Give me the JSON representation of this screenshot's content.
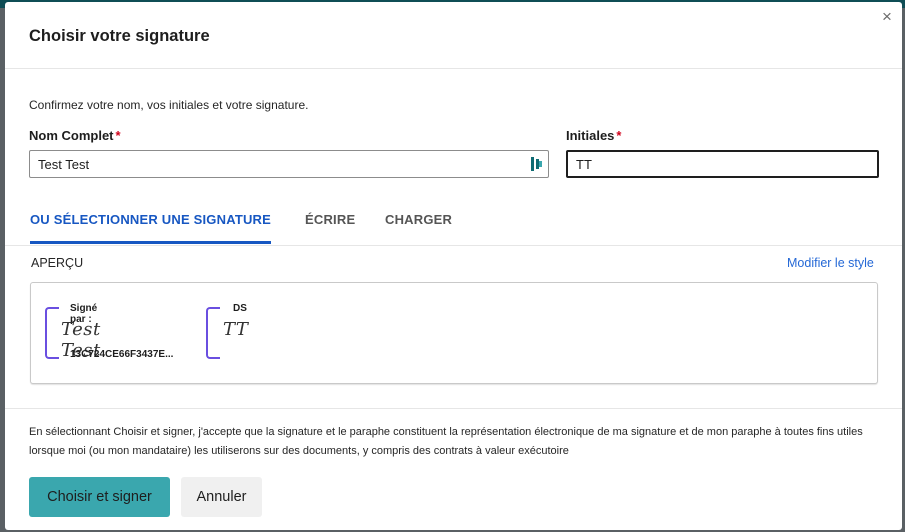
{
  "dialog": {
    "title": "Choisir votre signature",
    "close_glyph": "×",
    "intro": "Confirmez votre nom, vos initiales et votre signature."
  },
  "form": {
    "full_name_label": "Nom Complet",
    "full_name_value": "Test Test",
    "initials_label": "Initiales",
    "initials_value": "TT",
    "required_mark": "*"
  },
  "tabs": [
    {
      "label": "OU SÉLECTIONNER UNE SIGNATURE",
      "active": true
    },
    {
      "label": "ÉCRIRE",
      "active": false
    },
    {
      "label": "CHARGER",
      "active": false
    }
  ],
  "preview": {
    "label": "APERÇU",
    "modify_link": "Modifier le style",
    "signature": {
      "signed_by_label": "Signé par :",
      "script_text": "Test Test",
      "id": "13C724CE66F3437E..."
    },
    "initials": {
      "label": "DS",
      "script_text": "TT"
    }
  },
  "disclaimer": "En sélectionnant Choisir et signer, j'accepte que la signature et le paraphe constituent la représentation électronique de ma signature et de mon paraphe à toutes fins utiles lorsque moi (ou mon mandataire) les utiliserons sur des documents, y compris des contrats à valeur exécutoire",
  "buttons": {
    "primary": "Choisir et signer",
    "secondary": "Annuler"
  },
  "colors": {
    "accent_blue": "#1757c2",
    "primary_button": "#3aa7ae",
    "bracket_purple": "#6a4fe0",
    "required_red": "#d0021b"
  },
  "icons": {
    "close": "close-icon",
    "password_manager": "password-manager-icon"
  }
}
